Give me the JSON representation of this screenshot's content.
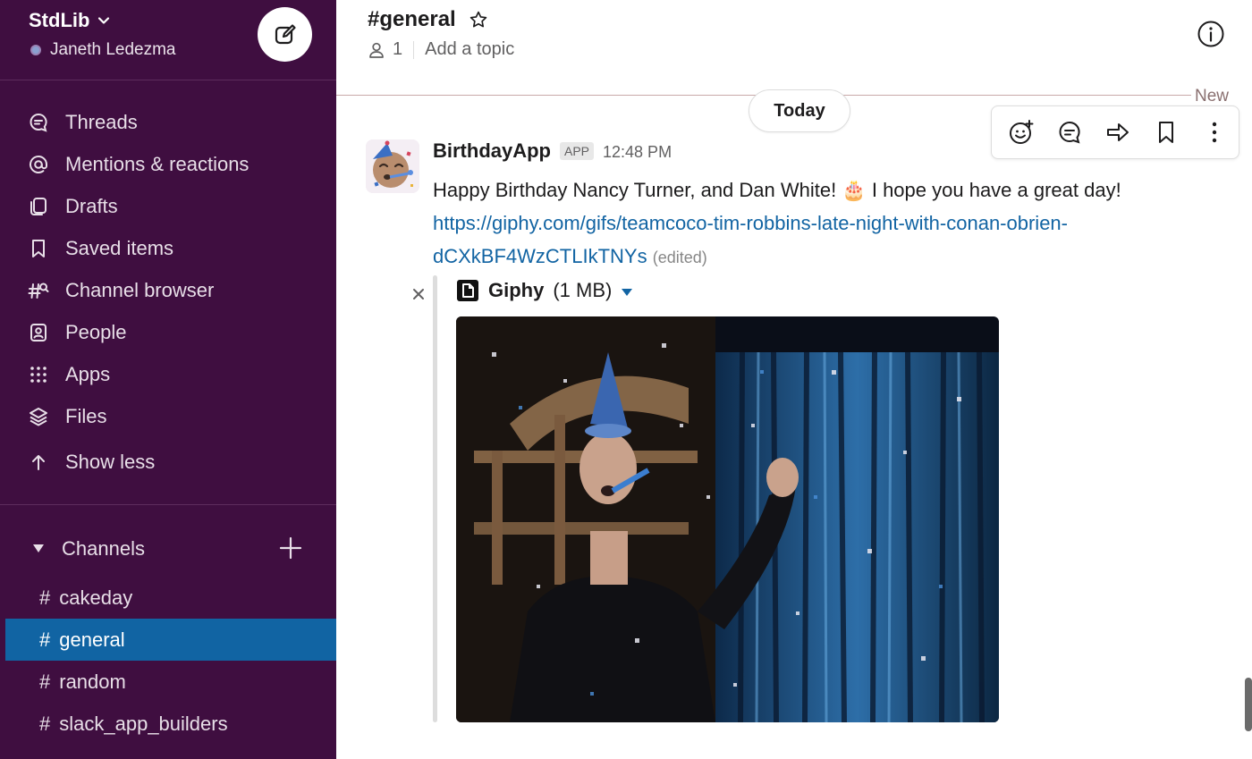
{
  "workspace": {
    "name": "StdLib",
    "user": "Janeth Ledezma"
  },
  "sidebar": {
    "items": [
      {
        "label": "Threads",
        "icon": "threads-icon"
      },
      {
        "label": "Mentions & reactions",
        "icon": "at-icon"
      },
      {
        "label": "Drafts",
        "icon": "drafts-icon"
      },
      {
        "label": "Saved items",
        "icon": "bookmark-icon"
      },
      {
        "label": "Channel browser",
        "icon": "channel-browser-icon"
      },
      {
        "label": "People",
        "icon": "people-icon"
      },
      {
        "label": "Apps",
        "icon": "apps-icon"
      },
      {
        "label": "Files",
        "icon": "files-icon"
      },
      {
        "label": "Show less",
        "icon": "arrow-up-icon"
      }
    ],
    "channels_header": "Channels",
    "channels": [
      {
        "name": "cakeday",
        "active": false
      },
      {
        "name": "general",
        "active": true
      },
      {
        "name": "random",
        "active": false
      },
      {
        "name": "slack_app_builders",
        "active": false
      }
    ],
    "colors": {
      "background": "#3f0e40",
      "active": "#1164a3"
    }
  },
  "channel": {
    "title": "#general",
    "member_count": "1",
    "topic_placeholder": "Add a topic"
  },
  "feed": {
    "new_label": "New",
    "date_divider": "Today"
  },
  "message": {
    "sender": "BirthdayApp",
    "badge": "APP",
    "time": "12:48 PM",
    "text": "Happy Birthday Nancy Turner, and Dan White! 🎂 I hope you have a great day!",
    "link_line1": "https://giphy.com/gifs/teamcoco-tim-robbins-late-night-with-conan-obrien-",
    "link_line2": "dCXkBF4WzCTLIkTNYs",
    "edited": "(edited)"
  },
  "attachment": {
    "title": "Giphy",
    "size": "(1 MB)",
    "caret": "▾"
  }
}
